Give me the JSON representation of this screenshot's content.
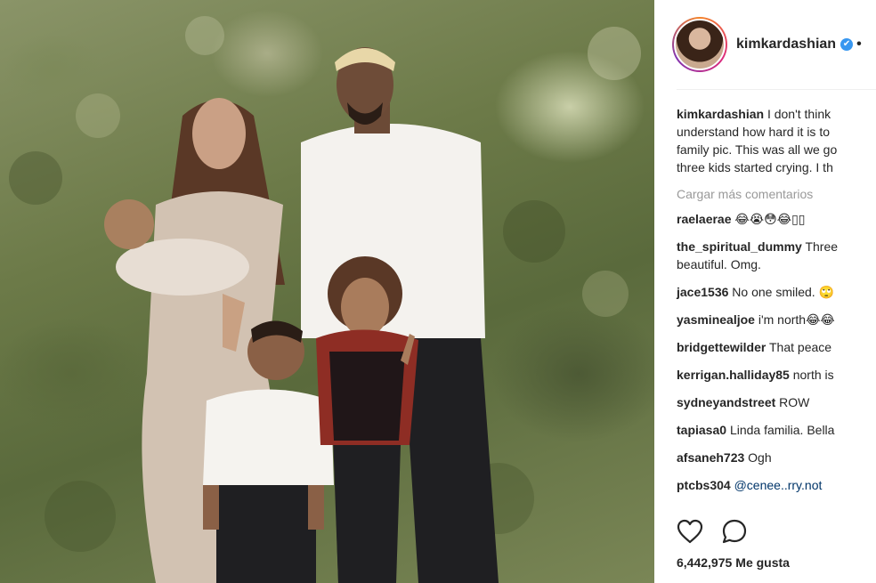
{
  "post": {
    "username": "kimkardashian",
    "follow_dot": "•",
    "verified_glyph": "✔"
  },
  "caption": {
    "username": "kimkardashian",
    "lines": [
      "I don't think",
      "understand how hard it is to",
      "family pic. This was all we go",
      "three kids started crying. I th"
    ]
  },
  "load_more": "Cargar más comentarios",
  "comments": [
    {
      "user": "raelaerae",
      "text": "😂😭😳😂▯▯"
    },
    {
      "user": "the_spiritual_dummy",
      "text": "Three",
      "text2": "beautiful. Omg."
    },
    {
      "user": "jace1536",
      "text": "No one smiled. 🙄"
    },
    {
      "user": "yasminealjoe",
      "text": "i'm north😂😂"
    },
    {
      "user": "bridgettewilder",
      "text": "That peace"
    },
    {
      "user": "kerrigan.halliday85",
      "text": "north is"
    },
    {
      "user": "sydneyandstreet",
      "text": "ROW"
    },
    {
      "user": "tapiasa0",
      "text": "Linda familia. Bella"
    },
    {
      "user": "afsaneh723",
      "text": "Ogh"
    },
    {
      "user": "ptcbs304",
      "text": "@cenee..rry.not"
    }
  ],
  "likes": {
    "count": "6,442,975",
    "label": "Me gusta"
  },
  "icons": {
    "like": "heart-icon",
    "comment": "comment-bubble-icon",
    "verified": "verified-badge-icon"
  },
  "colors": {
    "verified": "#3897f0",
    "muted": "#999999",
    "text": "#262626"
  }
}
